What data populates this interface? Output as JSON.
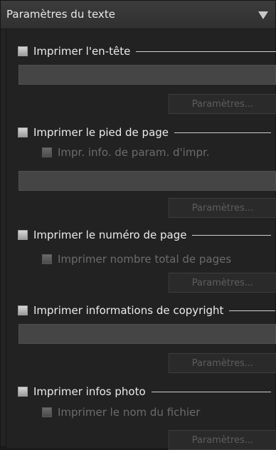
{
  "panel": {
    "title": "Paramètres du texte",
    "collapse_icon": "triangle-down-icon"
  },
  "sections": {
    "header": {
      "checkbox_label": "Imprimer l'en-tête",
      "checked": false,
      "settings_button": "Paramètres..."
    },
    "footer": {
      "checkbox_label": "Imprimer le pied de page",
      "checked": false,
      "sub_checkbox_label": "Impr. info. de param. d'impr.",
      "settings_button": "Paramètres..."
    },
    "page_number": {
      "checkbox_label": "Imprimer le numéro de page",
      "checked": false,
      "sub_checkbox_label": "Imprimer nombre total de pages",
      "settings_button": "Paramètres..."
    },
    "copyright": {
      "checkbox_label": "Imprimer informations de copyright",
      "checked": false,
      "settings_button": "Paramètres..."
    },
    "photo_info": {
      "checkbox_label": "Imprimer infos photo",
      "checked": false,
      "sub_checkbox_label": "Imprimer le nom du fichier",
      "settings_button": "Paramètres..."
    }
  }
}
